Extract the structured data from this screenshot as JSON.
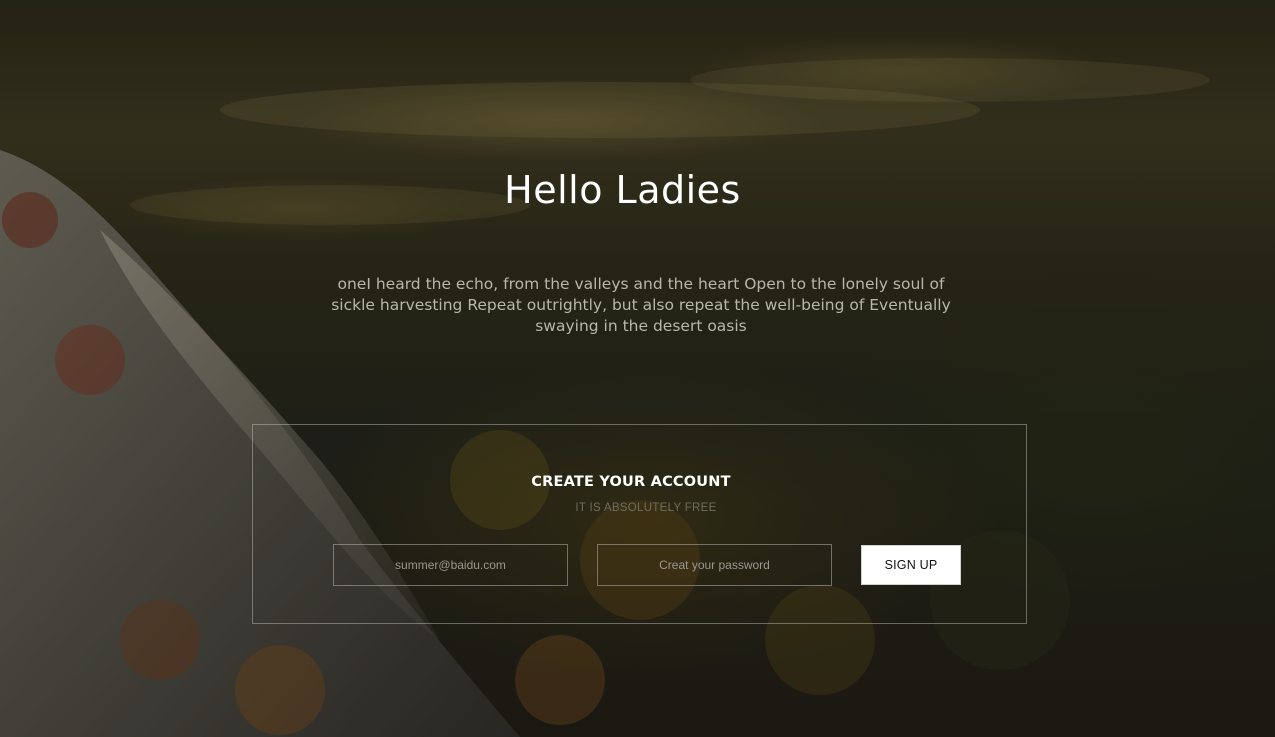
{
  "hero": {
    "title": "Hello Ladies",
    "subtitle": "oneI heard the echo, from the valleys and the heart Open to the lonely soul of sickle harvesting Repeat outrightly, but also repeat the well-being of Eventually swaying in the desert oasis"
  },
  "signup": {
    "heading": "CREATE YOUR ACCOUNT",
    "subheading": "IT IS ABSOLUTELY FREE",
    "email_placeholder": "summer@baidu.com",
    "password_placeholder": "Creat your password",
    "button_label": "SIGN UP"
  },
  "colors": {
    "title_text": "#ffffff",
    "subtitle_text": "#b9b6ac",
    "box_border": "#8a8a8a",
    "button_bg": "#ffffff",
    "button_text": "#111111"
  }
}
